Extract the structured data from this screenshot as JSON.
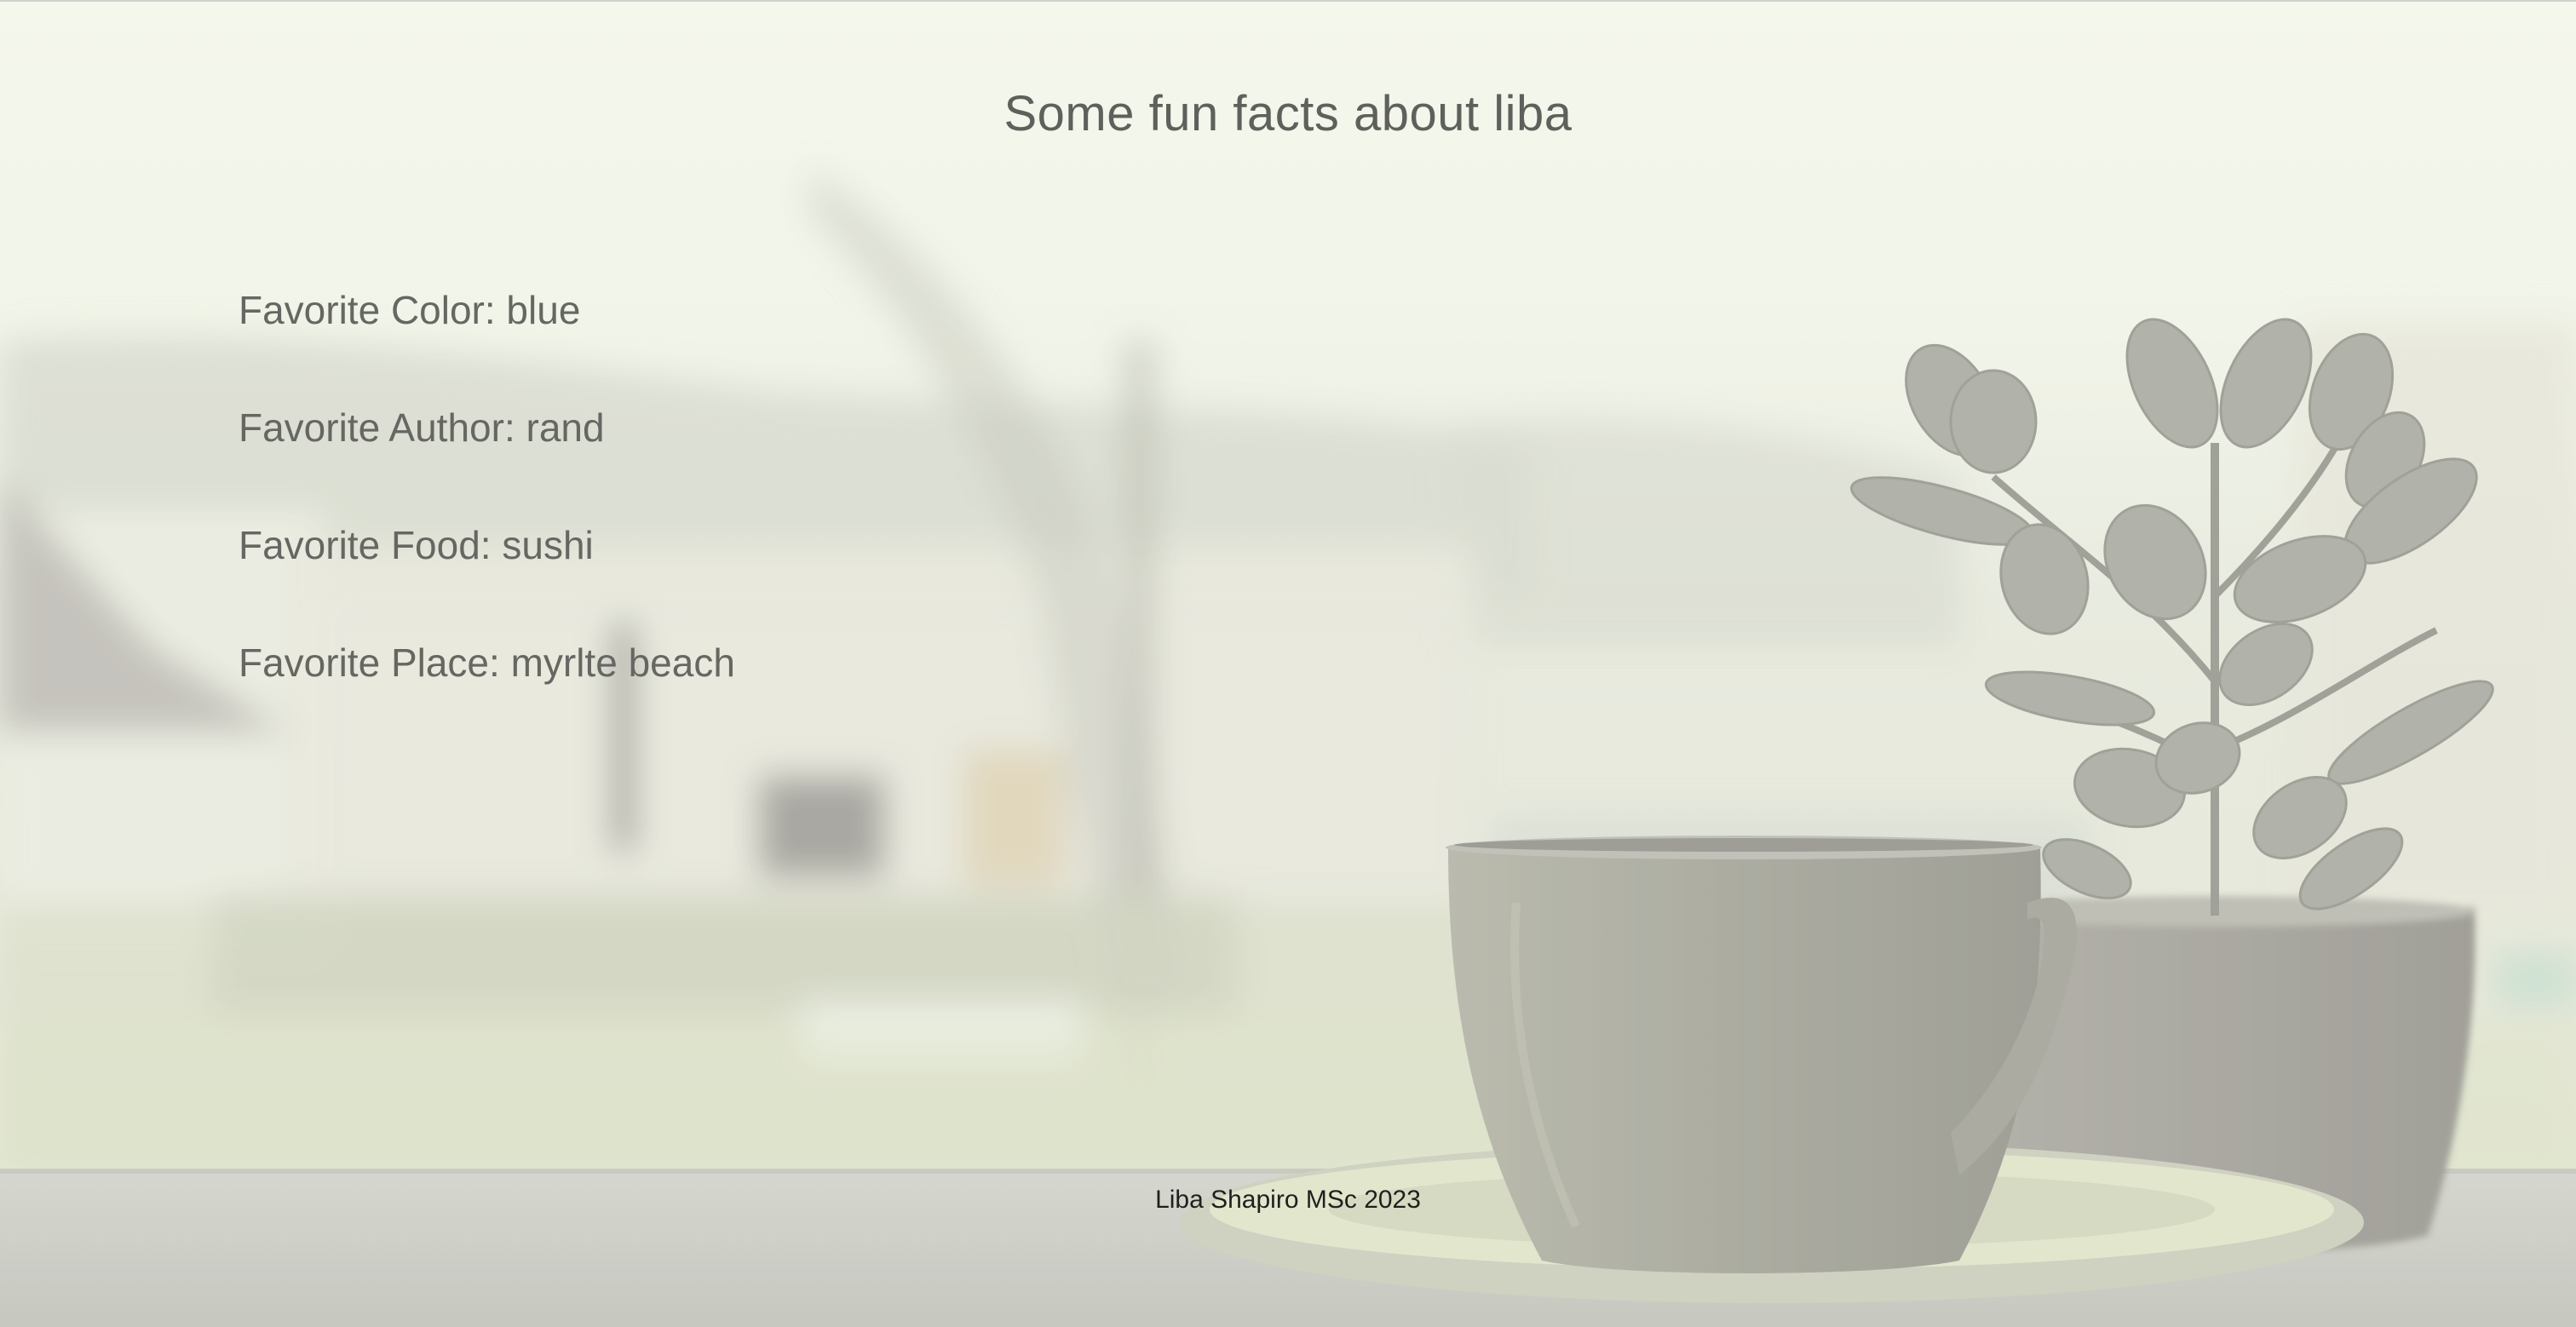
{
  "page": {
    "title": "Some fun facts about liba",
    "facts": [
      "Favorite Color: blue",
      "Favorite Author: rand",
      "Favorite Food: sushi",
      "Favorite Place: myrlte beach"
    ],
    "footer": "Liba Shapiro MSc 2023"
  },
  "background": {
    "image_name": "coffee-cup-and-plant-by-window",
    "sky_color": "#f3f6ea",
    "hills_color": "#cfd2c6",
    "table_color": "#c9c9c3"
  }
}
